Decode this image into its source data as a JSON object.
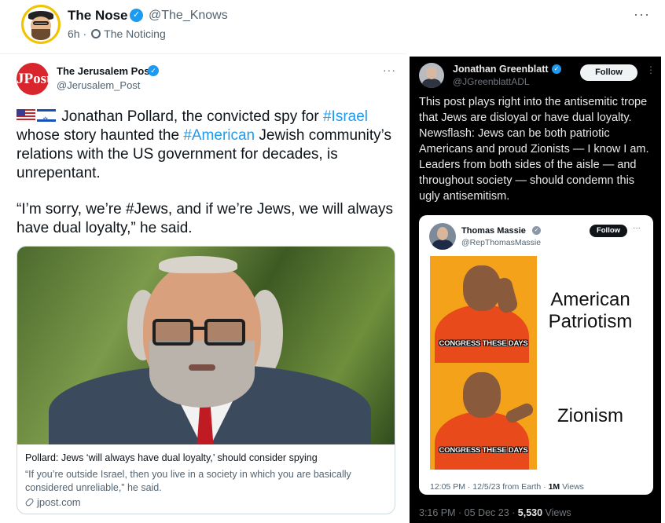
{
  "outer_post": {
    "author": "The Nose",
    "handle": "@The_Knows",
    "time": "6h",
    "sep": "·",
    "location": "The Noticing",
    "more": "···"
  },
  "jpost": {
    "avatar_text": "JPost",
    "name": "The Jerusalem Post",
    "handle": "@Jerusalem_Post",
    "more": "···",
    "text_p1_a": "Jonathan Pollard, the convicted spy for ",
    "tag_israel": "#Israel",
    "text_p1_b": " whose story haunted the ",
    "tag_american": "#American",
    "text_p1_c": " Jewish community’s relations with the US government for decades, is unrepentant.",
    "quote_a": "“I’m sorry, we’re ",
    "tag_jews": "#Jews",
    "quote_b": ", and if we’re Jews, we will always have dual loyalty,” he said.",
    "card": {
      "title": "Pollard: Jews ‘will always have dual loyalty,’ should consider spying",
      "description": "“If you’re outside Israel, then you live in a society in which you are basically considered unreliable,” he said.",
      "domain": "jpost.com"
    }
  },
  "greenblatt": {
    "name": "Jonathan Greenblatt",
    "handle": "@JGreenblattADL",
    "follow": "Follow",
    "more": "⋮",
    "text": "This post plays right into the antisemitic trope that Jews are disloyal or have dual loyalty. Newsflash: Jews can be both patriotic Americans and proud Zionists — I know I am. Leaders from both sides of the aisle — and throughout society — should condemn this ugly antisemitism.",
    "footer_time": "3:16 PM · 05 Dec 23 · ",
    "footer_views_count": "5,530",
    "footer_views_label": " Views"
  },
  "massie": {
    "name": "Thomas Massie",
    "handle": "@RepThomasMassie",
    "follow": "Follow",
    "more": "···",
    "meme": {
      "caption_top": "CONGRESS THESE DAYS",
      "caption_bottom": "CONGRESS THESE DAYS",
      "text_top": "American Patriotism",
      "text_bottom": "Zionism"
    },
    "footer_time": "12:05 PM · 12/5/23 from Earth · ",
    "footer_views_count": "1M",
    "footer_views_label": " Views"
  },
  "colors": {
    "link_blue": "#1d9bf0",
    "verified_blue": "#1d9bf0",
    "jpost_red": "#d8262c",
    "dark_bg": "#000000",
    "meme_orange": "#f4a21a"
  }
}
